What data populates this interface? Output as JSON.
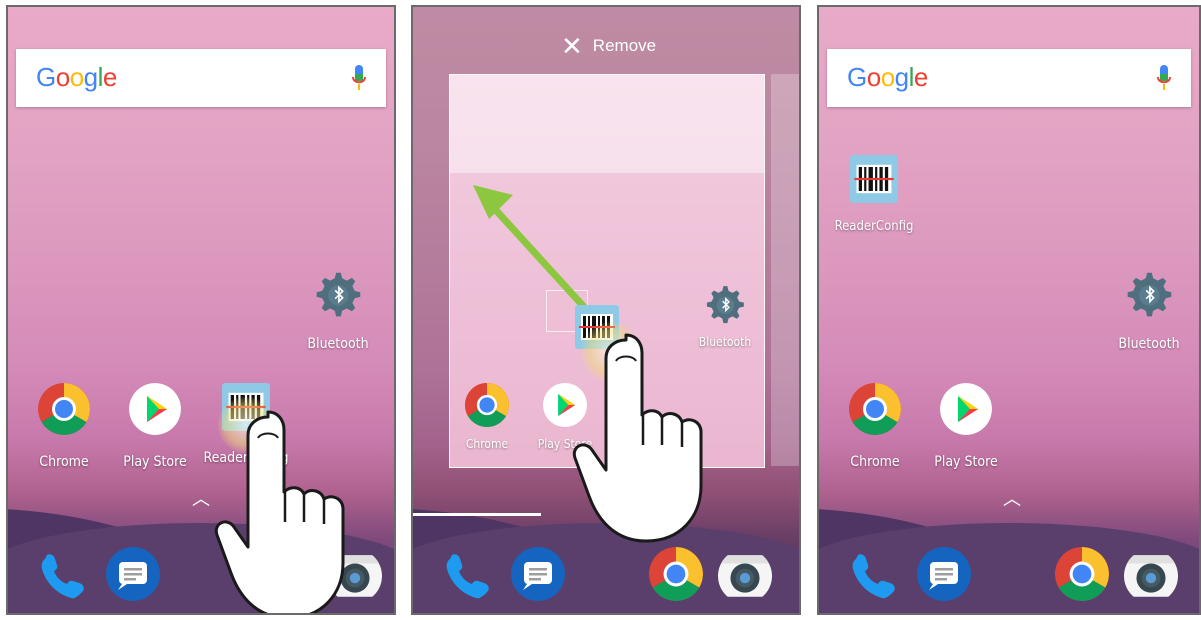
{
  "screens": [
    {
      "search": {
        "logo": "Google"
      },
      "apps": [
        {
          "label": "Chrome"
        },
        {
          "label": "Play Store"
        },
        {
          "label": "ReaderConfig"
        }
      ],
      "widgets": [
        {
          "label": "Bluetooth"
        }
      ],
      "dock": [
        "phone-icon",
        "messages-icon",
        "chrome-icon",
        "camera-icon"
      ]
    },
    {
      "remove": {
        "label": "Remove"
      },
      "apps": [
        {
          "label": "Chrome"
        },
        {
          "label": "Play Store"
        }
      ],
      "widgets": [
        {
          "label": "Bluetooth"
        }
      ],
      "dock": [
        "phone-icon",
        "messages-icon",
        "chrome-icon",
        "camera-icon"
      ]
    },
    {
      "search": {
        "logo": "Google"
      },
      "apps": [
        {
          "label": "ReaderConfig"
        },
        {
          "label": "Chrome"
        },
        {
          "label": "Play Store"
        }
      ],
      "widgets": [
        {
          "label": "Bluetooth"
        }
      ],
      "dock": [
        "phone-icon",
        "messages-icon",
        "chrome-icon",
        "camera-icon"
      ]
    }
  ],
  "colors": {
    "wallpaper_top": "#e9aac8",
    "wallpaper_bottom": "#5e3d6e",
    "drag_arrow": "#8dc63f"
  }
}
